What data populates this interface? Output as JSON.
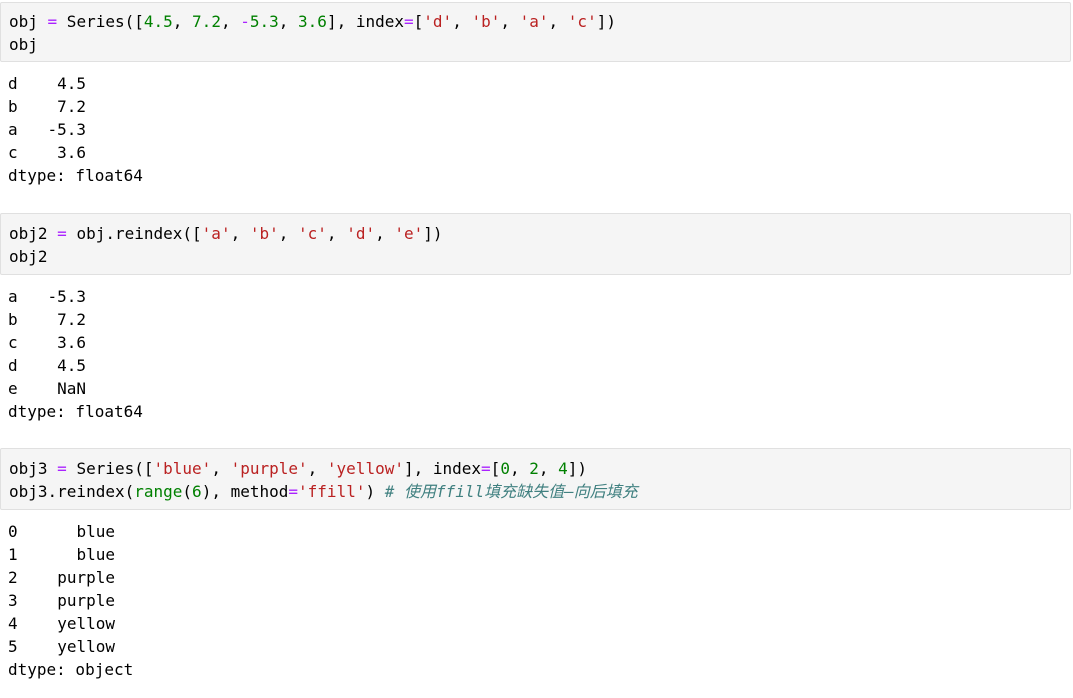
{
  "cells": [
    {
      "input": {
        "line1": {
          "t1": "obj ",
          "op1": "=",
          "t2": " Series([",
          "n1": "4.5",
          "t3": ", ",
          "n2": "7.2",
          "t4": ", ",
          "op2": "-",
          "n3": "5.3",
          "t5": ", ",
          "n4": "3.6",
          "t6": "], index",
          "op3": "=",
          "t7": "[",
          "s1": "'d'",
          "t8": ", ",
          "s2": "'b'",
          "t9": ", ",
          "s3": "'a'",
          "t10": ", ",
          "s4": "'c'",
          "t11": "])"
        },
        "line2": "obj"
      },
      "output": {
        "rows": [
          {
            "index": "d",
            "value": "4.5"
          },
          {
            "index": "b",
            "value": "7.2"
          },
          {
            "index": "a",
            "value": "-5.3"
          },
          {
            "index": "c",
            "value": "3.6"
          }
        ],
        "dtype": "dtype: float64"
      }
    },
    {
      "input": {
        "line1": {
          "t1": "obj2 ",
          "op1": "=",
          "t2": " obj.reindex([",
          "s1": "'a'",
          "t3": ", ",
          "s2": "'b'",
          "t4": ", ",
          "s3": "'c'",
          "t5": ", ",
          "s4": "'d'",
          "t6": ", ",
          "s5": "'e'",
          "t7": "])"
        },
        "line2": "obj2"
      },
      "output": {
        "rows": [
          {
            "index": "a",
            "value": "-5.3"
          },
          {
            "index": "b",
            "value": "7.2"
          },
          {
            "index": "c",
            "value": "3.6"
          },
          {
            "index": "d",
            "value": "4.5"
          },
          {
            "index": "e",
            "value": "NaN"
          }
        ],
        "dtype": "dtype: float64"
      }
    },
    {
      "input": {
        "line1": {
          "t1": "obj3 ",
          "op1": "=",
          "t2": " Series([",
          "s1": "'blue'",
          "t3": ", ",
          "s2": "'purple'",
          "t4": ", ",
          "s3": "'yellow'",
          "t5": "], index",
          "op2": "=",
          "t6": "[",
          "n1": "0",
          "t7": ", ",
          "n2": "2",
          "t8": ", ",
          "n3": "4",
          "t9": "])"
        },
        "line2": {
          "t1": "obj3.reindex(",
          "b1": "range",
          "t2": "(",
          "n1": "6",
          "t3": "), method",
          "op1": "=",
          "s1": "'ffill'",
          "t4": ") ",
          "c1": "# 使用ffill填充缺失值—向后填充"
        }
      },
      "output": {
        "rows": [
          {
            "index": "0",
            "value": "blue"
          },
          {
            "index": "1",
            "value": "blue"
          },
          {
            "index": "2",
            "value": "purple"
          },
          {
            "index": "3",
            "value": "purple"
          },
          {
            "index": "4",
            "value": "yellow"
          },
          {
            "index": "5",
            "value": "yellow"
          }
        ],
        "dtype": "dtype: object"
      }
    }
  ],
  "colors": {
    "cell_background": "#f5f5f5",
    "cell_border": "#e0e0e0",
    "operator": "#aa22ff",
    "number": "#008000",
    "string": "#ba2121",
    "comment": "#408080"
  }
}
